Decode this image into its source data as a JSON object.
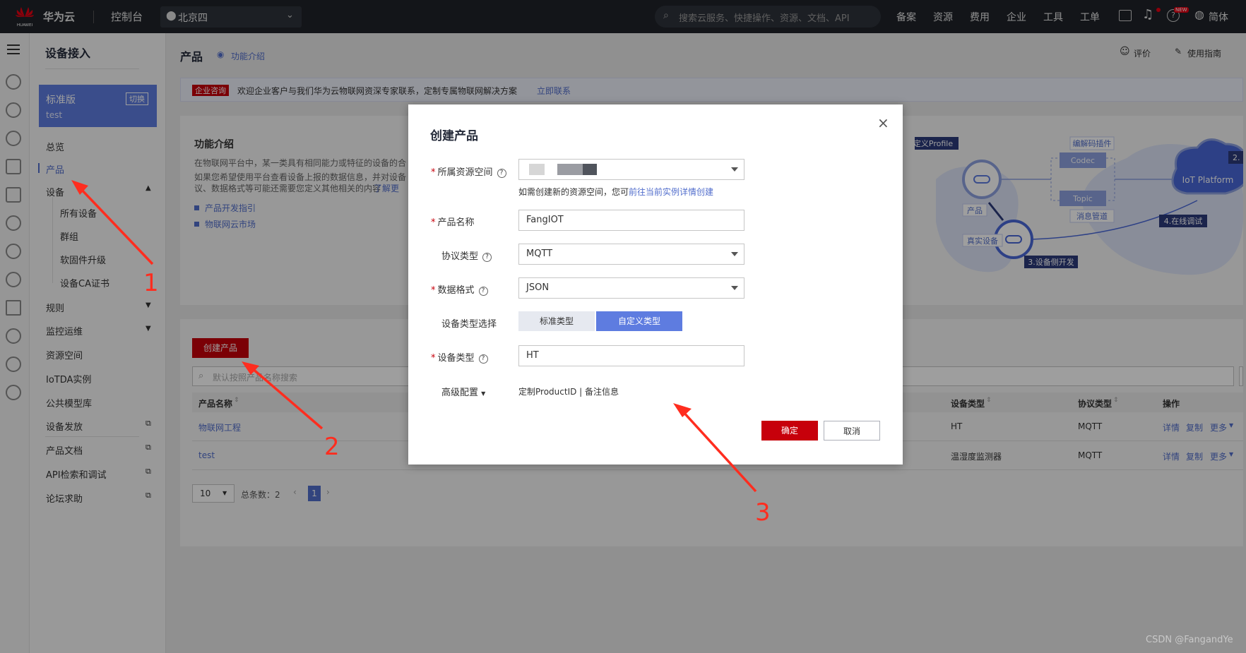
{
  "topbar": {
    "brand": "华为云",
    "brand_sub": "HUAWEI",
    "console": "控制台",
    "region": "北京四",
    "search_placeholder": "搜索云服务、快捷操作、资源、文档、API",
    "nav": [
      "备案",
      "资源",
      "费用",
      "企业",
      "工具",
      "工单"
    ],
    "lang": "简体",
    "badge": "NEW"
  },
  "sidebar": {
    "title": "设备接入",
    "edition": "标准版",
    "switch": "切换",
    "instance": "test",
    "items": [
      "总览",
      "产品",
      "设备",
      "规则",
      "监控运维",
      "资源空间",
      "IoTDA实例",
      "公共模型库",
      "设备发放",
      "产品文档",
      "API检索和调试",
      "论坛求助"
    ],
    "sub_items": [
      "所有设备",
      "群组",
      "软固件升级",
      "设备CA证书"
    ]
  },
  "page": {
    "title": "产品",
    "intro_link": "功能介绍",
    "rate": "评价",
    "guide": "使用指南",
    "banner_tag": "企业咨询",
    "banner_text": "欢迎企业客户与我们华为云物联网资深专家联系，定制专属物联网解决方案",
    "banner_link": "立即联系",
    "intro_title": "功能介绍",
    "intro_p1": "在物联网平台中，某一类具有相同能力或特征的设备的合",
    "intro_p2a": "如果您希望使用平台查看设备上报的数据信息，并对设备",
    "intro_p2b": "议、数据格式等可能还需要您定义其他相关的内容",
    "intro_more": "了解更",
    "link1": "产品开发指引",
    "link2": "物联网云市场"
  },
  "diagram": {
    "profile": "定义Profile",
    "codec_plugin": "编解码插件",
    "codec": "Codec",
    "topic": "Topic",
    "msg_pipe": "消息管道",
    "product": "产品",
    "real_device": "真实设备",
    "step3": "3.设备侧开发",
    "step4": "4.在线调试",
    "platform": "IoT Platform",
    "step2": "2."
  },
  "list": {
    "create_btn": "创建产品",
    "search_placeholder": "默认按照产品名称搜索",
    "columns": [
      "产品名称",
      "设备类型",
      "协议类型",
      "操作"
    ],
    "rows": [
      {
        "name": "物联网工程",
        "device_type": "HT",
        "protocol": "MQTT"
      },
      {
        "name": "test",
        "device_type": "温湿度监测器",
        "protocol": "MQTT"
      }
    ],
    "actions": [
      "详情",
      "复制",
      "更多"
    ],
    "page_size": "10",
    "total": "总条数：2",
    "current_page": "1"
  },
  "modal": {
    "title": "创建产品",
    "close": "×",
    "resource_space_label": "所属资源空间",
    "resource_hint": "如需创建新的资源空间，您可",
    "resource_hint_link": "前往当前实例详情创建",
    "product_name_label": "产品名称",
    "product_name_value": "FangIOT",
    "protocol_label": "协议类型",
    "protocol_value": "MQTT",
    "data_format_label": "数据格式",
    "data_format_value": "JSON",
    "device_type_select_label": "设备类型选择",
    "seg_standard": "标准类型",
    "seg_custom": "自定义类型",
    "device_type_label": "设备类型",
    "device_type_value": "HT",
    "advanced_label": "高级配置",
    "advanced_text": "定制ProductID | 备注信息",
    "ok": "确定",
    "cancel": "取消"
  },
  "annotations": [
    "1",
    "2",
    "3"
  ],
  "watermark": "CSDN @FangandYe",
  "colors": {
    "brand": "#c7000b",
    "link": "#526ecc",
    "topbar": "#1f2329"
  }
}
